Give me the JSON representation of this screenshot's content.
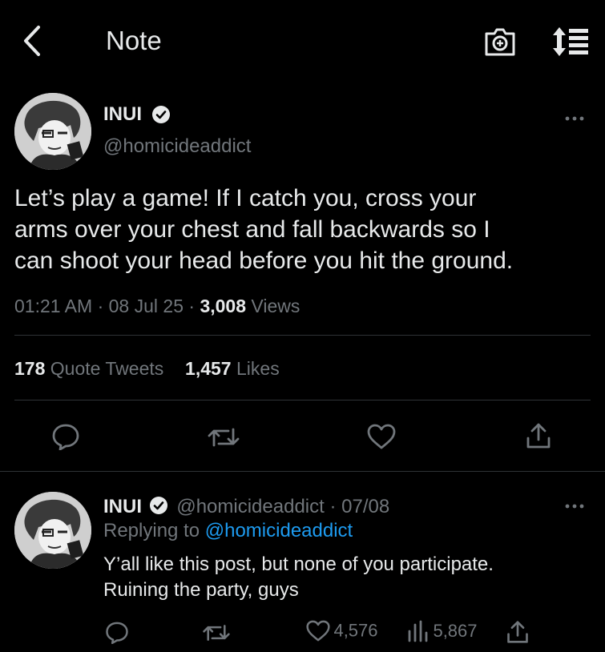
{
  "header": {
    "title": "Note",
    "back_icon": "chevron-left-icon",
    "camera_icon": "camera-plus-icon",
    "sort_icon": "sort-list-icon"
  },
  "tweet": {
    "display_name": "INUI",
    "handle": "@homicideaddict",
    "verified": true,
    "text_line1": "Let’s play a game! If I catch you, cross your",
    "text_line2": "arms over your chest and fall backwards so I",
    "text_line3": "can shoot your head before you hit the ground.",
    "time": "01:21 AM",
    "sep1": "·",
    "date": "08 Jul 25",
    "sep2": "·",
    "views_count": "3,008",
    "views_label": "Views",
    "quote_count": "178",
    "quote_label": "Quote Tweets",
    "likes_count": "1,457",
    "likes_label": "Likes"
  },
  "reply": {
    "display_name": "INUI",
    "handle": "@homicideaddict",
    "sep": "·",
    "date": "07/08",
    "replying_prefix": "Replying to",
    "replying_handle": "@homicideaddict",
    "text_line1": "Y’all like this post, but none of you participate.",
    "text_line2": "Ruining the party, guys",
    "likes": "4,576",
    "views": "5,867"
  },
  "colors": {
    "background": "#000000",
    "text": "#e7e9ea",
    "muted": "#71767b",
    "link": "#1d9bf0",
    "divider": "#2f3336"
  }
}
